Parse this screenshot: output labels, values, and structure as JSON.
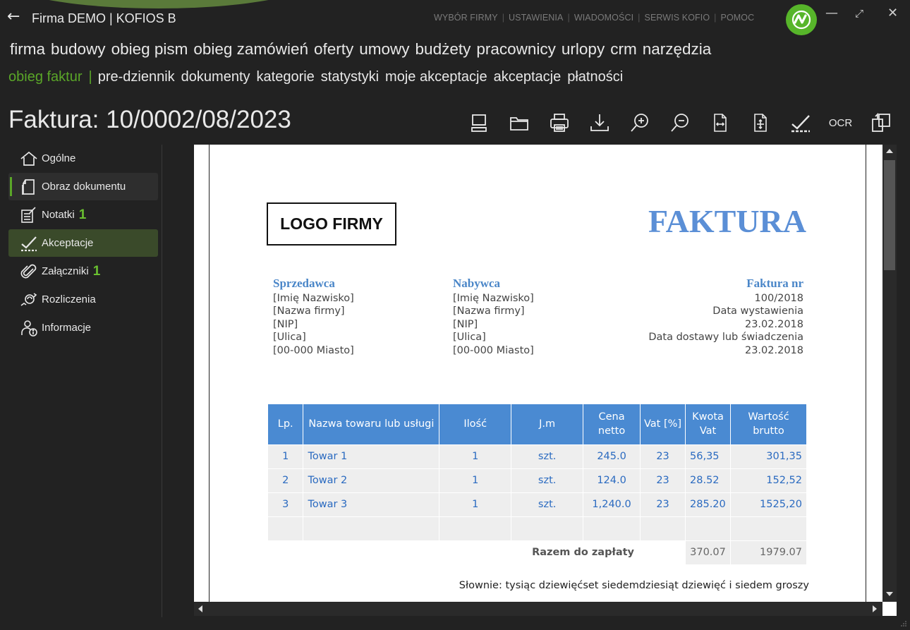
{
  "window": {
    "back_arrow": "←",
    "title": "Firma DEMO | KOFIOS B",
    "top_menu": [
      "WYBÓR FIRMY",
      "USTAWIENIA",
      "WIADOMOŚCI",
      "SERWIS KOFIO",
      "POMOC"
    ],
    "minimize": "—",
    "maximize": "⤢",
    "close": "✕"
  },
  "nav_primary": [
    "firma",
    "budowy",
    "obieg pism",
    "obieg zamówień",
    "oferty",
    "umowy",
    "budżety",
    "pracownicy",
    "urlopy",
    "crm",
    "narzędzia"
  ],
  "nav_secondary": {
    "active": "obieg faktur",
    "divider": "|",
    "items": [
      "pre-dziennik",
      "dokumenty",
      "kategorie",
      "statystyki",
      "moje akceptacje",
      "akceptacje",
      "płatności"
    ]
  },
  "document": {
    "title": "Faktura: 10/0002/08/2023",
    "toolbar": {
      "ocr_label": "OCR",
      "icons": [
        "scanner-icon",
        "folder-icon",
        "print-icon",
        "download-icon",
        "zoom-in-icon",
        "zoom-out-icon",
        "fit-width-icon",
        "fit-page-icon",
        "approve-icon",
        "ocr",
        "export-icon"
      ]
    }
  },
  "sidebar": {
    "items": [
      {
        "label": "Ogólne",
        "icon": "home-icon"
      },
      {
        "label": "Obraz dokumentu",
        "icon": "document-image-icon"
      },
      {
        "label": "Notatki",
        "icon": "notes-icon",
        "badge": "1"
      },
      {
        "label": "Akceptacje",
        "icon": "approve-icon"
      },
      {
        "label": "Załączniki",
        "icon": "paperclip-icon",
        "badge": "1"
      },
      {
        "label": "Rozliczenia",
        "icon": "settlement-icon"
      },
      {
        "label": "Informacje",
        "icon": "user-info-icon"
      }
    ]
  },
  "invoice": {
    "logo_text": "LOGO FIRMY",
    "heading": "FAKTURA",
    "seller": {
      "heading": "Sprzedawca",
      "lines": [
        "[Imię Nazwisko]",
        "[Nazwa firmy]",
        "[NIP]",
        "[Ulica]",
        "[00-000 Miasto]"
      ]
    },
    "buyer": {
      "heading": "Nabywca",
      "lines": [
        "[Imię Nazwisko]",
        "[Nazwa firmy]",
        "[NIP]",
        "[Ulica]",
        "[00-000 Miasto]"
      ]
    },
    "details": {
      "heading": "Faktura nr",
      "lines": [
        "100/2018",
        "Data wystawienia",
        "23.02.2018",
        "Data dostawy lub świadczenia",
        "23.02.2018"
      ]
    },
    "table": {
      "headers": [
        "Lp.",
        "Nazwa towaru lub usługi",
        "Ilość",
        "J.m",
        "Cena netto",
        "Vat [%]",
        "Kwota Vat",
        "Wartość brutto"
      ],
      "rows": [
        [
          "1",
          "Towar 1",
          "1",
          "szt.",
          "245.0",
          "23",
          "56,35",
          "301,35"
        ],
        [
          "2",
          "Towar 2",
          "1",
          "szt.",
          "124.0",
          "23",
          "28.52",
          "152,52"
        ],
        [
          "3",
          "Towar 3",
          "1",
          "szt.",
          "1,240.0",
          "23",
          "285.20",
          "1525,20"
        ]
      ],
      "total_label": "Razem do zapłaty",
      "total_vat": "370.07",
      "total_brutto": "1979.07"
    },
    "slownie": "Słownie:  tysiąc dziewięćset siedemdziesiąt dziewięć i siedem groszy"
  }
}
